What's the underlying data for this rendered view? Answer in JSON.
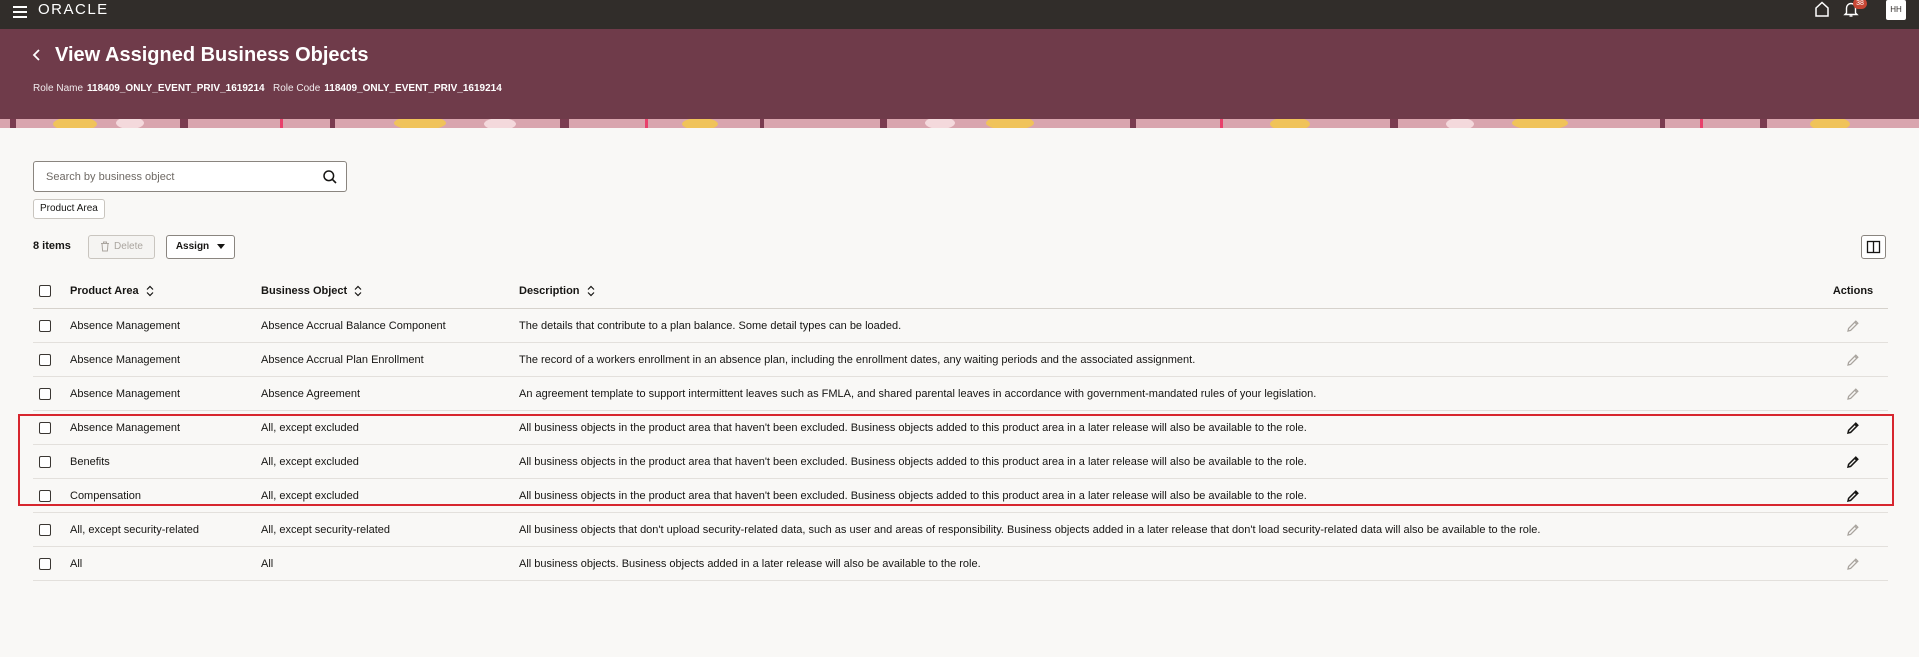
{
  "topbar": {
    "brand": "ORACLE",
    "notification_count": "38",
    "avatar_initials": "HH"
  },
  "header": {
    "title": "View Assigned Business Objects",
    "role_name_label": "Role Name",
    "role_name_value": "118409_ONLY_EVENT_PRIV_1619214",
    "role_code_label": "Role Code",
    "role_code_value": "118409_ONLY_EVENT_PRIV_1619214"
  },
  "search": {
    "placeholder": "Search by business object",
    "value": ""
  },
  "filter_chip": "Product Area",
  "toolbar": {
    "item_count": "8 items",
    "delete_label": "Delete",
    "assign_label": "Assign"
  },
  "table": {
    "columns": {
      "product_area": "Product Area",
      "business_object": "Business Object",
      "description": "Description",
      "actions": "Actions"
    },
    "rows": [
      {
        "product_area": "Absence Management",
        "business_object": "Absence Accrual Balance Component",
        "description": "The details that contribute to a plan balance. Some detail types can be loaded."
      },
      {
        "product_area": "Absence Management",
        "business_object": "Absence Accrual Plan Enrollment",
        "description": "The record of a workers enrollment in an absence plan, including the enrollment dates, any waiting periods and the associated assignment."
      },
      {
        "product_area": "Absence Management",
        "business_object": "Absence Agreement",
        "description": "An agreement template to support intermittent leaves such as FMLA, and shared parental leaves in accordance with government-mandated rules of your legislation."
      },
      {
        "product_area": "Absence Management",
        "business_object": "All, except excluded",
        "description": "All business objects in the product area that haven't been excluded. Business objects added to this product area in a later release will also be available to the role."
      },
      {
        "product_area": "Benefits",
        "business_object": "All, except excluded",
        "description": "All business objects in the product area that haven't been excluded. Business objects added to this product area in a later release will also be available to the role."
      },
      {
        "product_area": "Compensation",
        "business_object": "All, except excluded",
        "description": "All business objects in the product area that haven't been excluded. Business objects added to this product area in a later release will also be available to the role."
      },
      {
        "product_area": "All, except security-related",
        "business_object": "All, except security-related",
        "description": "All business objects that don't upload security-related data, such as user and areas of responsibility. Business objects added in a later release that don't load security-related data will also be available to the role."
      },
      {
        "product_area": "All",
        "business_object": "All",
        "description": "All business objects. Business objects added in a later release will also be available to the role."
      }
    ]
  },
  "colors": {
    "topbar": "#312d2a",
    "header": "#6f3b4a",
    "highlight_border": "#d7262e",
    "edit_active": "#161513",
    "edit_inactive": "#a9a49e"
  },
  "icons": {
    "menu": "hamburger-menu-icon",
    "home": "home-icon",
    "notifications": "bell-icon",
    "back": "chevron-left-icon",
    "search": "search-icon",
    "delete": "trash-icon",
    "columns": "panel-columns-icon",
    "sort": "sort-icon",
    "edit": "pencil-icon"
  }
}
